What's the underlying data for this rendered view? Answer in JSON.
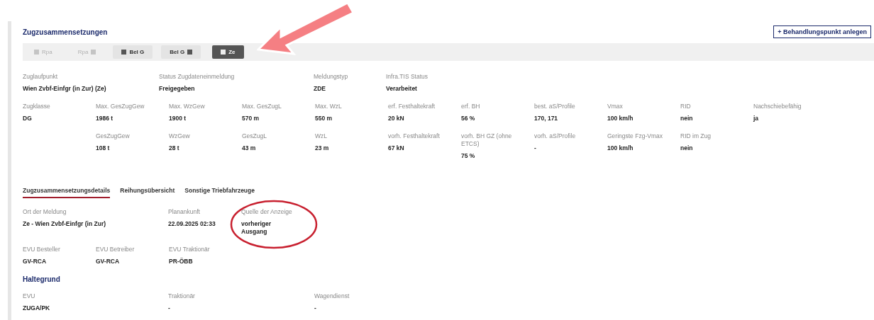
{
  "section": {
    "title": "Zugzusammensetzungen",
    "action_button": "+ Behandlungspunkt anlegen"
  },
  "points": [
    {
      "label": "Rpa",
      "kind": "icon-left",
      "disabled": true,
      "selected": false
    },
    {
      "label": "Rpa",
      "kind": "icon-right",
      "disabled": true,
      "selected": false
    },
    {
      "label": "Bel G",
      "kind": "icon-left",
      "disabled": false,
      "selected": false
    },
    {
      "label": "Bel G",
      "kind": "icon-right",
      "disabled": false,
      "selected": false
    },
    {
      "label": "Ze",
      "kind": "icon-left",
      "disabled": false,
      "selected": true
    }
  ],
  "summary": [
    {
      "label": "Zuglaufpunkt",
      "value": "Wien Zvbf-Einfgr (in Zur) (Ze)"
    },
    {
      "label": "Status Zugdateneinmeldung",
      "value": "Freigegeben"
    },
    {
      "label": "Meldungstyp",
      "value": "ZDE"
    },
    {
      "label": "Infra.TIS Status",
      "value": "Verarbeitet"
    }
  ],
  "limits": [
    {
      "label": "Zugklasse",
      "value": "DG"
    },
    {
      "label": "Max. GesZugGew",
      "value": "1986 t"
    },
    {
      "label": "Max. WzGew",
      "value": "1900 t"
    },
    {
      "label": "Max. GesZugL",
      "value": "570 m"
    },
    {
      "label": "Max. WzL",
      "value": "550 m"
    },
    {
      "label": "erf. Festhaltekraft",
      "value": "20 kN"
    },
    {
      "label": "erf. BH",
      "value": "56 %"
    },
    {
      "label": "best. aS/Profile",
      "value": "170, 171"
    },
    {
      "label": "Vmax",
      "value": "100 km/h"
    },
    {
      "label": "RID",
      "value": "nein"
    },
    {
      "label": "Nachschiebefähig",
      "value": "ja"
    }
  ],
  "actuals": [
    {
      "label": "GesZugGew",
      "value": "108 t"
    },
    {
      "label": "WzGew",
      "value": "28 t"
    },
    {
      "label": "GesZugL",
      "value": "43 m"
    },
    {
      "label": "WzL",
      "value": "23 m"
    },
    {
      "label": "vorh. Festhaltekraft",
      "value": "67 kN"
    },
    {
      "label": "vorh. BH GZ (ohne ETCS)",
      "value": "75 %"
    },
    {
      "label": "vorh. aS/Profile",
      "value": "-"
    },
    {
      "label": "Geringste Fzg-Vmax",
      "value": "100 km/h"
    },
    {
      "label": "RID im Zug",
      "value": "nein"
    }
  ],
  "tabs": [
    {
      "label": "Zugzusammensetzungsdetails",
      "selected": true
    },
    {
      "label": "Reihungsübersicht",
      "selected": false
    },
    {
      "label": "Sonstige Triebfahrzeuge",
      "selected": false
    }
  ],
  "details": [
    {
      "label": "Ort der Meldung",
      "value": "Ze - Wien Zvbf-Einfgr (in Zur)"
    },
    {
      "label": "Planankunft",
      "value": "22.09.2025 02:33"
    },
    {
      "label": "Quelle der Anzeige",
      "value": "vorheriger Ausgang"
    }
  ],
  "operators": [
    {
      "label": "EVU Besteller",
      "value": "GV-RCA"
    },
    {
      "label": "EVU Betreiber",
      "value": "GV-RCA"
    },
    {
      "label": "EVU Traktionär",
      "value": "PR-ÖBB"
    }
  ],
  "halt": {
    "title": "Haltegrund",
    "fields": [
      {
        "label": "EVU",
        "value": "ZUGA/PK"
      },
      {
        "label": "Traktionär",
        "value": "-"
      },
      {
        "label": "Wagendienst",
        "value": "-"
      }
    ]
  }
}
